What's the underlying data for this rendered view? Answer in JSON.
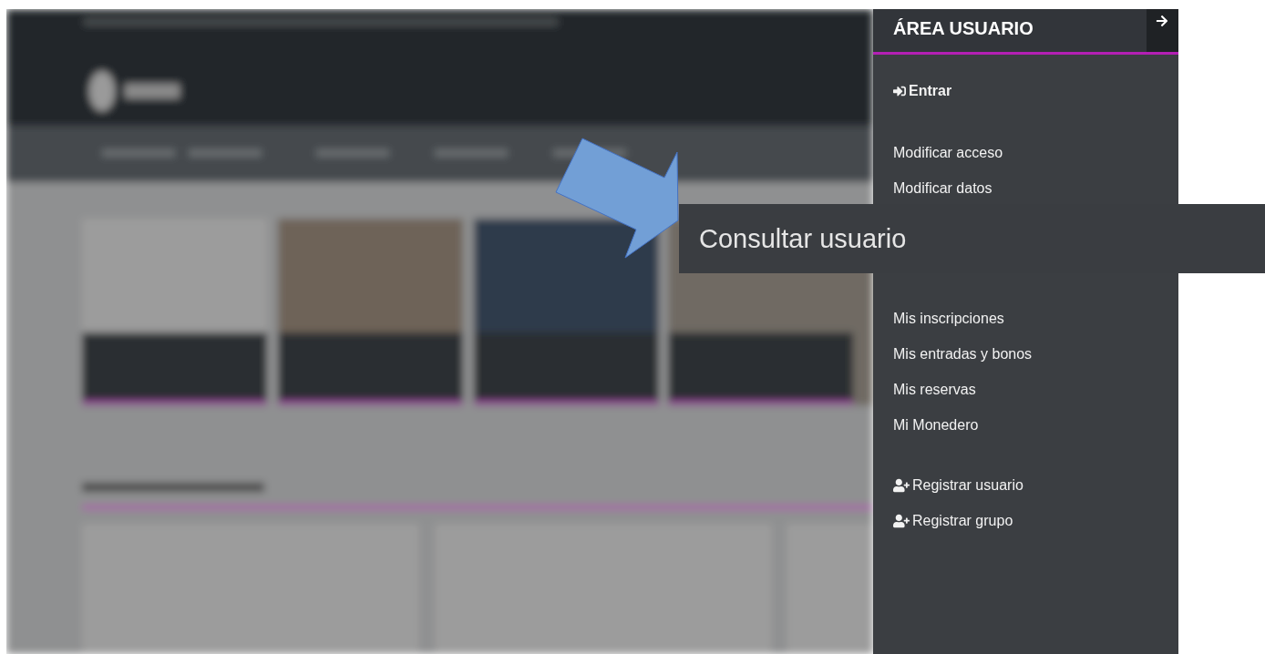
{
  "user_panel": {
    "title": "ÁREA USUARIO",
    "sections": [
      [
        {
          "label": "Entrar",
          "kind": "login"
        }
      ],
      [
        {
          "label": "Modificar acceso",
          "kind": "link"
        },
        {
          "label": "Modificar datos",
          "kind": "link"
        }
      ],
      [
        {
          "label": "Mis inscripciones",
          "kind": "link"
        },
        {
          "label": "Mis entradas y bonos",
          "kind": "link"
        },
        {
          "label": "Mis reservas",
          "kind": "link"
        },
        {
          "label": "Mi Monedero",
          "kind": "link"
        }
      ],
      [
        {
          "label": "Registrar usuario",
          "kind": "register"
        },
        {
          "label": "Registrar grupo",
          "kind": "register"
        }
      ]
    ]
  },
  "callout": {
    "label": "Consultar usuario"
  }
}
